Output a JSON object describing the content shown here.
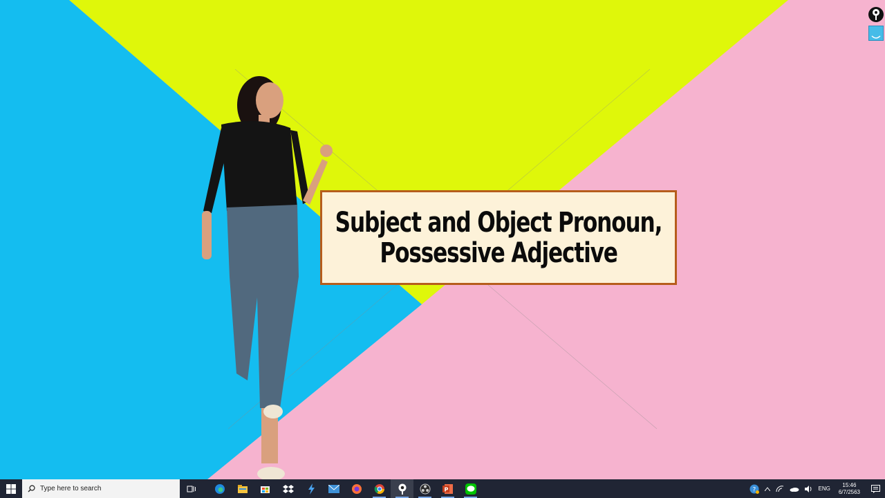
{
  "slide": {
    "title_line1": "Subject and Object Pronoun,",
    "title_line2": "Possessive Adjective"
  },
  "colors": {
    "blue": "#14bdf0",
    "yellow": "#dff70a",
    "pink": "#f6b3cf",
    "card_bg": "#fdf2d9",
    "card_border": "#b65d1c",
    "taskbar": "#202534"
  },
  "taskbar": {
    "search_placeholder": "Type here to search",
    "apps": [
      "task-view-icon",
      "edge-icon",
      "file-explorer-icon",
      "store-icon",
      "dropbox-icon",
      "visual-studio-icon",
      "mail-icon",
      "firefox-icon",
      "chrome-icon",
      "pin-app-icon",
      "obs-icon",
      "powerpoint-icon",
      "line-icon"
    ],
    "language": "ENG",
    "time": "15:46",
    "date": "6/7/2563"
  }
}
